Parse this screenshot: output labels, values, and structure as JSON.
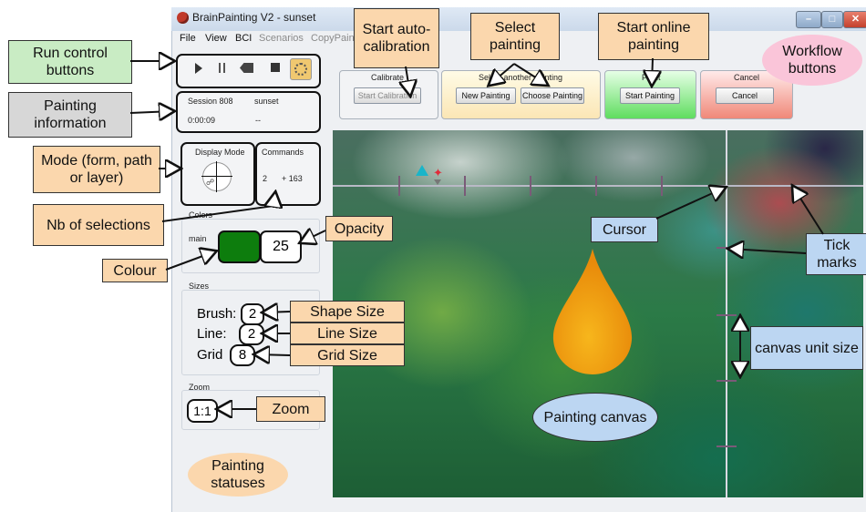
{
  "window": {
    "title": "BrainPainting V2 - sunset",
    "controls": {
      "minimize": "–",
      "maximize": "□",
      "close": "✕"
    }
  },
  "menu": [
    "File",
    "View",
    "BCI",
    "Scenarios",
    "CopyPaint"
  ],
  "session": {
    "label": "Session 808",
    "name": "sunset",
    "time": "0:00:09",
    "extra": "--"
  },
  "display_mode": {
    "label": "Display Mode"
  },
  "commands": {
    "label": "Commands",
    "count": "2",
    "selections": "+ 163"
  },
  "colors": {
    "label": "Colors",
    "main": "main",
    "main_color": "#0d7d0d",
    "opacity": "25"
  },
  "sizes": {
    "label": "Sizes",
    "brush_label": "Brush:",
    "brush": "2",
    "line_label": "Line:",
    "line": "2",
    "grid_label": "Grid",
    "grid": "8"
  },
  "zoom": {
    "label": "Zoom",
    "value": "1:1"
  },
  "workflow": {
    "calibrate": {
      "title": "Calibrate",
      "button": "Start Calibration"
    },
    "select": {
      "title": "Select another painting",
      "new": "New Painting",
      "choose": "Choose Painting"
    },
    "paint": {
      "title": "Paint",
      "button": "Start Painting"
    },
    "cancel": {
      "title": "Cancel",
      "button": "Cancel"
    }
  },
  "callouts": {
    "run_control": "Run control buttons",
    "painting_info": "Painting information",
    "mode": "Mode (form, path or layer)",
    "nb_selections": "Nb of selections",
    "colour": "Colour",
    "opacity": "Opacity",
    "shape_size": "Shape Size",
    "line_size": "Line Size",
    "grid_size": "Grid Size",
    "zoom": "Zoom",
    "painting_statuses": "Painting statuses",
    "start_auto_calibration": "Start auto-calibration",
    "select_painting": "Select painting",
    "start_online_painting": "Start online painting",
    "workflow_buttons": "Workflow buttons",
    "cursor": "Cursor",
    "tick_marks": "Tick marks",
    "canvas_unit_size": "canvas unit size",
    "painting_canvas": "Painting canvas"
  },
  "colors_ui": {
    "accent_green": "#c9ecc4",
    "accent_orange": "#fbd7ad",
    "accent_blue": "#bcd6f2",
    "accent_pink": "#fac5d9"
  }
}
